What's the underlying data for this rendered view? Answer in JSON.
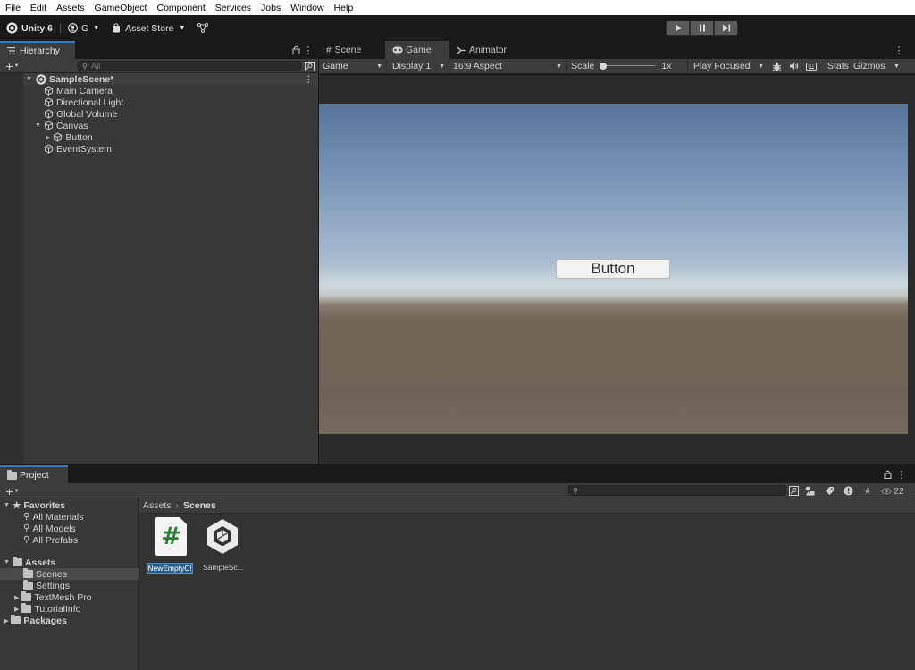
{
  "menu": [
    "File",
    "Edit",
    "Assets",
    "GameObject",
    "Component",
    "Services",
    "Jobs",
    "Window",
    "Help"
  ],
  "toolbar": {
    "product": "Unity 6",
    "account_initial": "G",
    "asset_store": "Asset Store",
    "cloud_icon": "collab-icon",
    "play_icons": [
      "play-icon",
      "pause-icon",
      "step-icon"
    ]
  },
  "hierarchy": {
    "tab_label": "Hierarchy",
    "search_placeholder": "All",
    "scene_name": "SampleScene*",
    "items": [
      {
        "label": "Main Camera"
      },
      {
        "label": "Directional Light"
      },
      {
        "label": "Global Volume"
      },
      {
        "label": "Canvas"
      },
      {
        "label": "Button"
      },
      {
        "label": "EventSystem"
      }
    ]
  },
  "game_view": {
    "tabs": [
      "Scene",
      "Game",
      "Animator"
    ],
    "mode": "Game",
    "display": "Display 1",
    "aspect": "16:9 Aspect",
    "scale_label": "Scale",
    "scale_value": "1x",
    "play_focus": "Play Focused",
    "stats": "Stats",
    "gizmos": "Gizmos",
    "ui_button_text": "Button"
  },
  "project": {
    "tab_label": "Project",
    "hidden_count": "22",
    "favorites_label": "Favorites",
    "favorites": [
      "All Materials",
      "All Models",
      "All Prefabs"
    ],
    "assets_label": "Assets",
    "asset_folders": [
      "Scenes",
      "Settings",
      "TextMesh Pro",
      "TutorialInfo"
    ],
    "packages_label": "Packages",
    "breadcrumb_root": "Assets",
    "breadcrumb_current": "Scenes",
    "files": [
      {
        "name": "NewEmptyC!",
        "type": "script"
      },
      {
        "name": "SampleSc...",
        "type": "scene"
      }
    ]
  },
  "colors": {
    "selection": "#2c5d87",
    "active_tab_accent": "#3a79bb",
    "script_hash": "#2e7d32"
  }
}
